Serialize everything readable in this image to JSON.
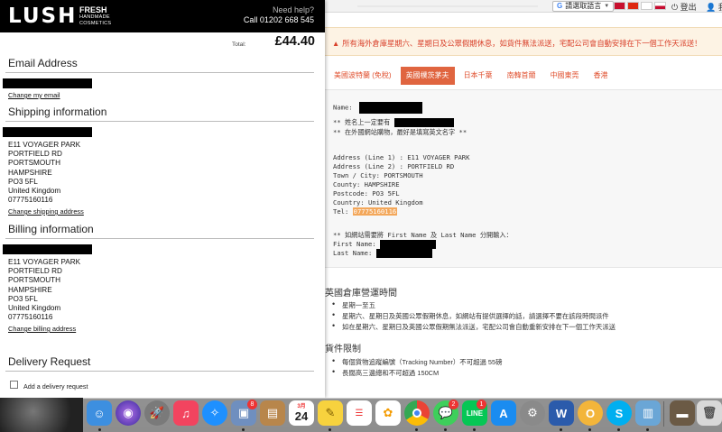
{
  "background_page": {
    "topbar": {
      "translate_label": "請選取語言",
      "login_label": "登出",
      "mine_label": "我的"
    },
    "notice": "所有海外倉庫星期六、星期日及公眾假期休息，如貨件無法派送，宅配公司會自動安排在下一個工作天派送！",
    "tabs": [
      "美國波特蘭 (免稅)",
      "英國樸茨茅夫",
      "日本千葉",
      "南韓首爾",
      "中國東莞",
      "香港"
    ],
    "active_tab": 1,
    "box": {
      "name_label": "Name:",
      "note1_prefix": "** 姓名上一定要有",
      "note2": "** 在外國網站購物，最好是填寫英文名字 **",
      "address_lines": [
        "Address (Line 1) : E11 VOYAGER PARK",
        "Address (Line 2) : PORTFIELD RD",
        "Town / City: PORTSMOUTH",
        "County: HAMPSHIRE",
        "Postcode: PO3 5FL",
        "Country: United Kingdom"
      ],
      "tel_label": "Tel:",
      "tel_value": "07775160116",
      "split_note": "** 如網站需要將 First Name 及 Last Name 分開輸入：",
      "first_name_label": "First Name:",
      "last_name_label": "Last Name:"
    },
    "hours": {
      "title": "英國倉庫營運時間",
      "items": [
        "星期一至五",
        "星期六、星期日及英國公眾假期休息，如網站有提供選擇的話，請選擇不要在該段時間派件",
        "如在星期六、星期日及英國公眾假期無法派送，宅配公司會自動重新安排在下一個工作天派送"
      ]
    },
    "limits": {
      "title": "貨件限制",
      "items": [
        "每個貨物追蹤編號（Tracking Number）不可超過 55磅",
        "長闊高三邊總和不可超過 150CM"
      ]
    }
  },
  "modal": {
    "logo": "LUSH",
    "tagline_main": "FRESH",
    "tagline_sub1": "HANDMADE",
    "tagline_sub2": "COSMETICS",
    "help_title": "Need help?",
    "help_phone": "Call 01202 668 545",
    "total_label": "Total:",
    "total_value": "£44.40",
    "email": {
      "title": "Email Address",
      "link": "Change my email"
    },
    "shipping": {
      "title": "Shipping information",
      "lines": [
        "E11 VOYAGER PARK",
        "PORTFIELD RD",
        "PORTSMOUTH",
        "HAMPSHIRE",
        "PO3 5FL",
        "United Kingdom",
        "07775160116"
      ],
      "link": "Change shipping address"
    },
    "billing": {
      "title": "Billing information",
      "lines": [
        "E11 VOYAGER PARK",
        "PORTFIELD RD",
        "PORTSMOUTH",
        "HAMPSHIRE",
        "PO3 5FL",
        "United Kingdom",
        "07775160116"
      ],
      "link": "Change billing address"
    },
    "delivery": {
      "title": "Delivery Request",
      "checkbox_label": "Add a delivery request"
    }
  },
  "dock": {
    "calendar_month": "3月",
    "calendar_day": "24",
    "badges": {
      "preview": "8",
      "messages": "2",
      "line": "1"
    },
    "colors": {
      "finder": "#3d8fe0",
      "siri": "#6a3fc9",
      "launchpad": "#7a7a7a",
      "music": "#f2445f",
      "safari": "#1e90ff",
      "preview": "#6f8fbf",
      "notes_brown": "#b8864b",
      "calendar": "#ffffff",
      "notes": "#f7d23e",
      "reminders": "#ffffff",
      "photos": "#ffffff",
      "chrome": "#ffffff",
      "messages": "#3ecf5b",
      "line": "#06c755",
      "appstore": "#1a8cf0",
      "settings": "#8a8a8a",
      "word": "#2b5bab",
      "outlook": "#f3b53a",
      "skype": "#00aff0",
      "photo_viewer": "#6aa6d6",
      "folder": "#6b5a45",
      "trash": "#d8d8d8"
    }
  }
}
